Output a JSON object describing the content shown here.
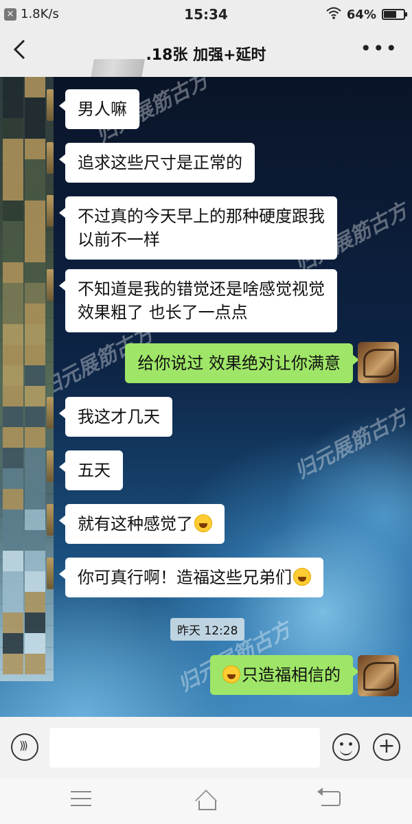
{
  "status_bar": {
    "net_speed": "1.8K/s",
    "time": "15:34",
    "battery": "64%",
    "battery_level": 0.64
  },
  "header": {
    "title": ".18张  加强+延时",
    "back_icon": "chevron-left-icon",
    "more_icon": "more-dots-icon"
  },
  "watermarks": [
    "归元展筋古方",
    "归元展筋古方",
    "归元展筋古方",
    "归元展筋古方"
  ],
  "messages": [
    {
      "side": "left",
      "text": "男人嘛"
    },
    {
      "side": "left",
      "text": "追求这些尺寸是正常的"
    },
    {
      "side": "left",
      "lines": [
        "不过真的今天早上的那种硬度跟我",
        "以前不一样"
      ]
    },
    {
      "side": "left",
      "lines": [
        "不知道是我的错觉还是啥感觉视觉",
        "效果粗了 也长了一点点"
      ]
    },
    {
      "side": "right",
      "text": "给你说过 效果绝对让你满意"
    },
    {
      "side": "left",
      "text": "我这才几天"
    },
    {
      "side": "left",
      "text": "五天"
    },
    {
      "side": "left",
      "text": "就有这种感觉了",
      "emoji": "tears-of-joy-emoji"
    },
    {
      "side": "left",
      "text": "你可真行啊！造福这些兄弟们",
      "emoji": "smiling-blush-emoji"
    },
    {
      "side": "right",
      "text": "只造福相信的",
      "emoji": "tears-of-joy-emoji"
    }
  ],
  "timestamp": "昨天 12:28",
  "input_bar": {
    "voice_icon": "voice-icon",
    "emoji_icon": "smiley-icon",
    "plus_icon": "plus-icon"
  },
  "nav_bar": {
    "menu_icon": "menu-icon",
    "home_icon": "home-icon",
    "back_icon": "back-icon"
  }
}
